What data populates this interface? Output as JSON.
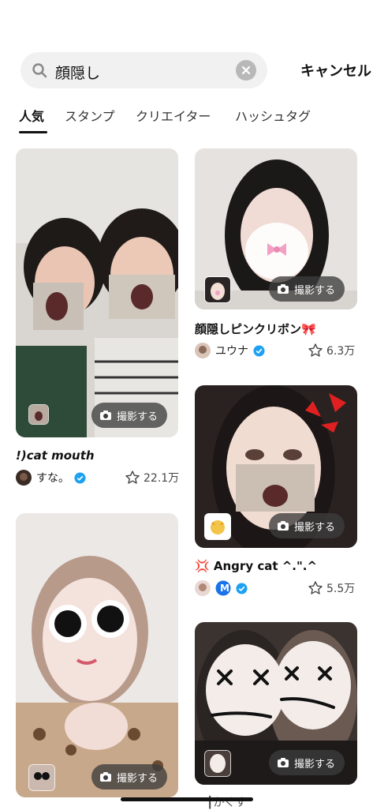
{
  "search": {
    "query": "顔隠し",
    "cancel_label": "キャンセル"
  },
  "tabs": [
    {
      "label": "人気"
    },
    {
      "label": "スタンプ"
    },
    {
      "label": "クリエイター"
    },
    {
      "label": "ハッシュタグ"
    }
  ],
  "shoot_label": "撮影する",
  "cards": [
    {
      "title": "!)cat mouth",
      "author": "すな。",
      "favorites": "22.1万"
    },
    {
      "title": "顔隠しピンクリボン🎀",
      "author": "ユウナ",
      "favorites": "6.3万"
    },
    {
      "title": "💢 Angry cat ^.\".^",
      "author": "M",
      "favorites": "5.5万"
    },
    {
      "title": "",
      "author": ""
    }
  ],
  "peek_author": "┃かくす",
  "colors": {
    "verified": "#1da1f2",
    "search_bg": "#f1f1f1",
    "button_bg": "#3c3c3c"
  }
}
